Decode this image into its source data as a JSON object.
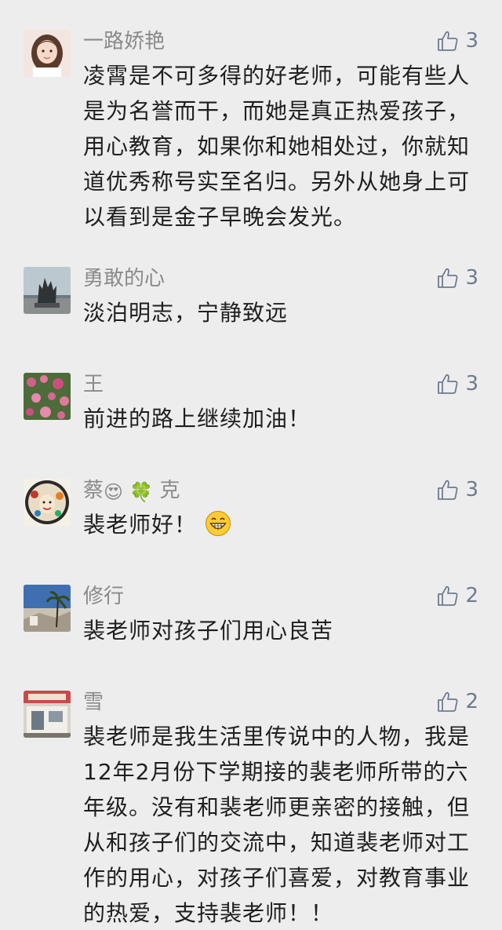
{
  "comments": [
    {
      "user": "一路娇艳",
      "likes": "3",
      "text": "凌霄是不可多得的好老师，可能有些人是为名誉而干，而她是真正热爱孩子，用心教育，如果你和她相处过，你就知道优秀称号实至名归。另外从她身上可以看到是金子早晚会发光。",
      "avatar_icon": "woman-portrait-avatar"
    },
    {
      "user": "勇敢的心",
      "likes": "3",
      "text": "淡泊明志，宁静致远",
      "avatar_icon": "sculpture-photo-avatar"
    },
    {
      "user": "王",
      "likes": "3",
      "text": "前进的路上继续加油！",
      "avatar_icon": "flowers-photo-avatar"
    },
    {
      "user_parts": [
        "蔡",
        "😍",
        "🍀",
        "克"
      ],
      "likes": "3",
      "text": "裴老师好！",
      "text_emoji": "grin-emoji",
      "avatar_icon": "clown-portrait-avatar"
    },
    {
      "user": "修行",
      "likes": "2",
      "text": "裴老师对孩子们用心良苦",
      "avatar_icon": "palm-tree-photo-avatar"
    },
    {
      "user": "雪",
      "likes": "2",
      "text": "裴老师是我生活里传说中的人物，我是12年2月份下学期接的裴老师所带的六年级。没有和裴老师更亲密的接触，但从和孩子们的交流中，知道裴老师对工作的用心，对孩子们喜爱，对教育事业的热爱，支持裴老师！！",
      "avatar_icon": "storefront-photo-avatar"
    }
  ],
  "colors": {
    "background": "#ededed",
    "name": "#8a8a8a",
    "text": "#1f1f1f",
    "like": "#6e7b8f"
  }
}
